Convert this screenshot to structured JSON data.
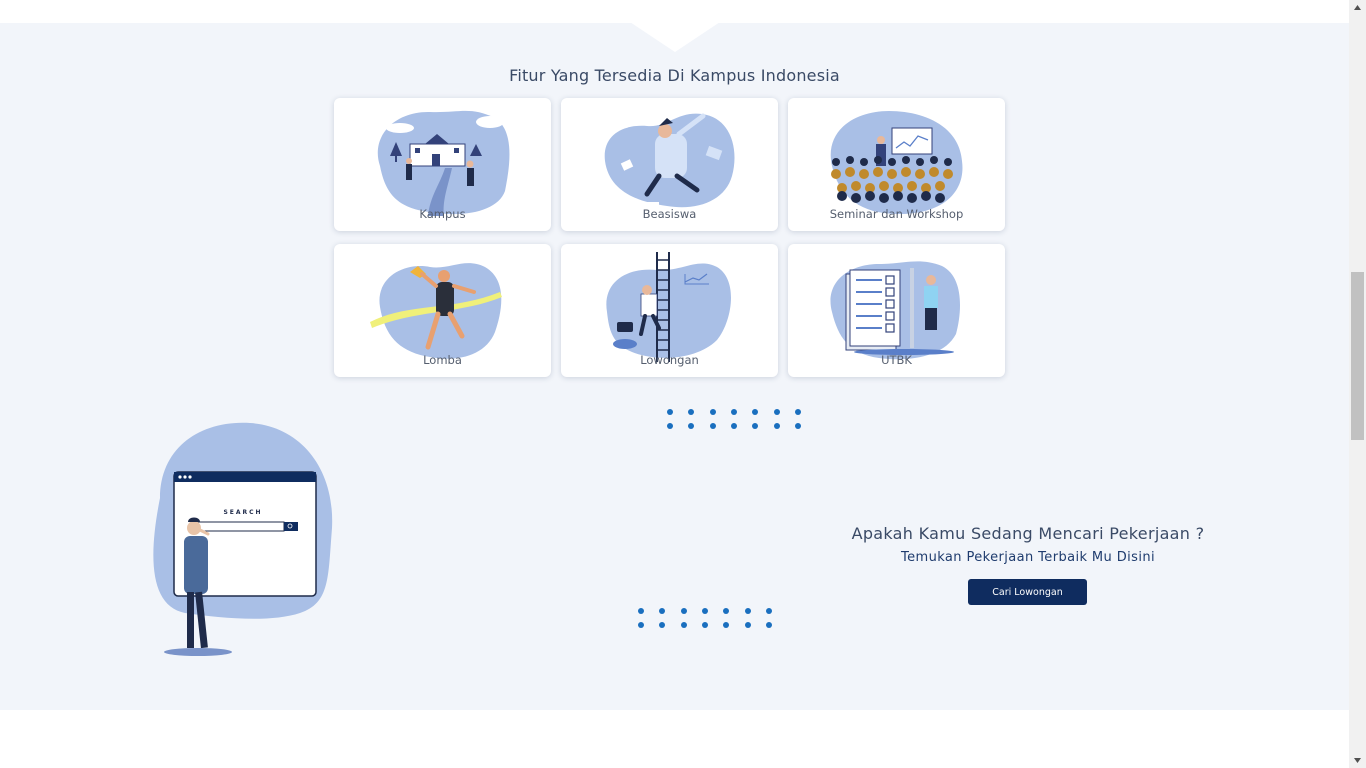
{
  "features": {
    "title": "Fitur Yang Tersedia Di Kampus Indonesia",
    "cards": [
      {
        "label": "Kampus",
        "icon": "campus-illustration"
      },
      {
        "label": "Beasiswa",
        "icon": "scholarship-illustration"
      },
      {
        "label": "Seminar dan Workshop",
        "icon": "seminar-illustration"
      },
      {
        "label": "Lomba",
        "icon": "competition-illustration"
      },
      {
        "label": "Lowongan",
        "icon": "job-ladder-illustration"
      },
      {
        "label": "UTBK",
        "icon": "exam-checklist-illustration"
      }
    ]
  },
  "job": {
    "question": "Apakah Kamu Sedang Mencari Pekerjaan ?",
    "subtitle": "Temukan Pekerjaan Terbaik Mu Disini",
    "button_label": "Cari Lowongan",
    "illustration_search_text": "SEARCH"
  },
  "colors": {
    "background": "#f2f5fa",
    "blob": "#a9bfe6",
    "dots": "#1a6fbf",
    "button": "#0f2c5f",
    "text": "#3a4a66"
  }
}
